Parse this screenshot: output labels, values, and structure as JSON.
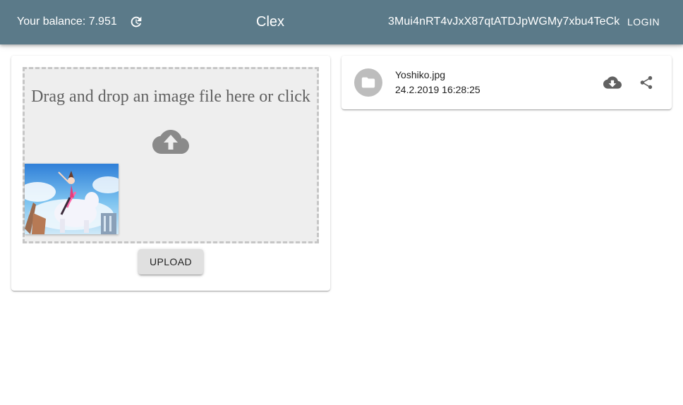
{
  "appbar": {
    "balance_text": "Your balance: 7.951",
    "title": "Clex",
    "address": "3Mui4nRT4vJxX87qtATDJpWGMy7xbu4TeCk",
    "login_label": "LOGIN",
    "refresh_icon": "refresh-icon",
    "background_color": "#5b7a89"
  },
  "upload": {
    "dropzone_text": "Drag and drop an image file here or click",
    "cloud_icon": "cloud-upload-icon",
    "preview_image": "anime-illustration-thumbnail",
    "upload_label": "UPLOAD"
  },
  "files": [
    {
      "name": "Yoshiko.jpg",
      "date": "24.2.2019 16:28:25",
      "avatar_icon": "folder-icon",
      "actions": [
        "cloud-download-icon",
        "share-icon"
      ]
    }
  ]
}
